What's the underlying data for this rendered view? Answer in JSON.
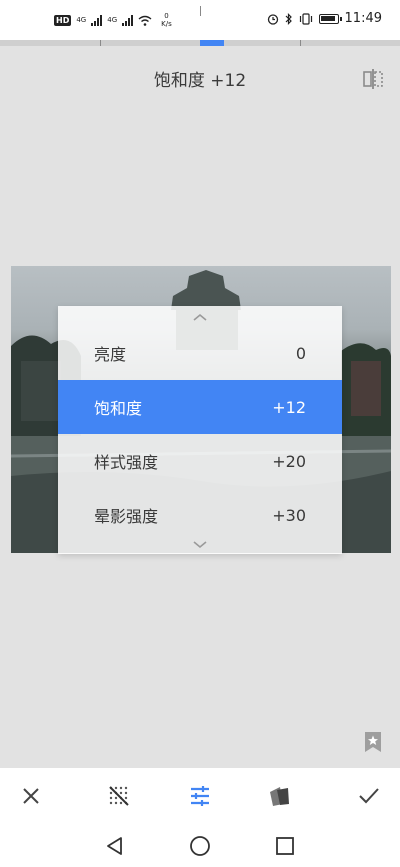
{
  "status_bar": {
    "hd_badge": "HD",
    "net_1": "4G",
    "net_2": "4G",
    "speed_value": "0",
    "speed_unit": "K/s",
    "time": "11:49"
  },
  "header": {
    "title": "饱和度 +12"
  },
  "menu": {
    "items": [
      {
        "label": "亮度",
        "value": "0",
        "selected": false
      },
      {
        "label": "饱和度",
        "value": "+12",
        "selected": true
      },
      {
        "label": "样式强度",
        "value": "+20",
        "selected": false
      },
      {
        "label": "晕影强度",
        "value": "+30",
        "selected": false
      }
    ]
  },
  "colors": {
    "accent": "#4285f4",
    "background": "#e2e2e2",
    "toolbar": "#ffffff"
  },
  "icons": {
    "compare": "compare-icon",
    "bookmark": "bookmark-star-icon",
    "cancel": "close-icon",
    "auto": "auto-adjust-icon",
    "tune": "tune-sliders-icon",
    "style": "styles-cards-icon",
    "apply": "check-icon",
    "nav_back": "triangle-back-icon",
    "nav_home": "circle-home-icon",
    "nav_recent": "square-recent-icon"
  }
}
